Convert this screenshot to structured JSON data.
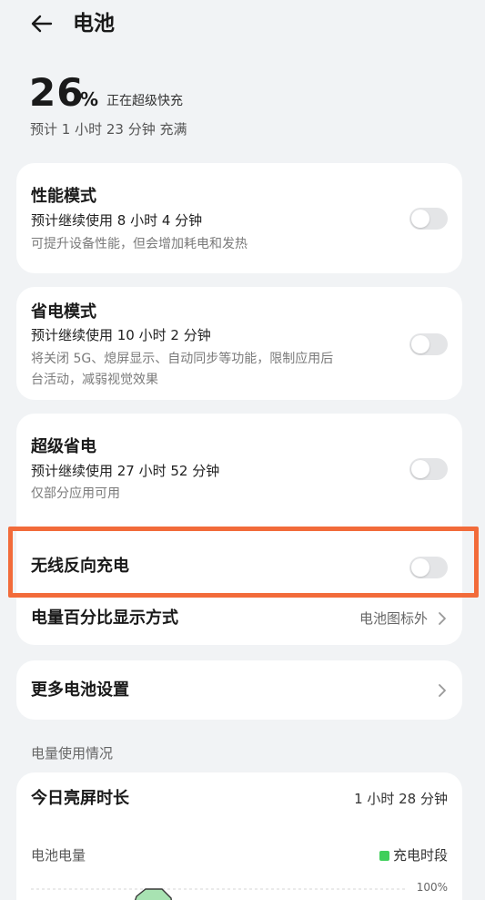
{
  "header": {
    "title": "电池"
  },
  "battery": {
    "percent": "26",
    "percent_sign": "%",
    "status": "正在超级快充",
    "eta": "预计 1 小时 23 分钟 充满"
  },
  "performance_mode": {
    "title": "性能模式",
    "line1": "预计继续使用 8 小时 4 分钟",
    "desc": "可提升设备性能，但会增加耗电和发热",
    "enabled": false
  },
  "power_saving_mode": {
    "title": "省电模式",
    "line1": "预计继续使用 10 小时 2 分钟",
    "desc_line1": "将关闭 5G、熄屏显示、自动同步等功能，限制应用后",
    "desc_line2": "台活动，减弱视觉效果",
    "enabled": false
  },
  "ultra_power_saving": {
    "title": "超级省电",
    "line1": "预计继续使用 27 小时 52 分钟",
    "desc": "仅部分应用可用",
    "enabled": false
  },
  "wireless_reverse_charging": {
    "title": "无线反向充电",
    "enabled": false
  },
  "battery_percentage_display": {
    "label": "电量百分比显示方式",
    "value": "电池图标外"
  },
  "more_settings": {
    "label": "更多电池设置"
  },
  "usage": {
    "section_label": "电量使用情况",
    "screen_time_title": "今日亮屏时长",
    "screen_time_value": "1 小时 28 分钟",
    "battery_level_label": "电池电量",
    "legend_charging": "充电时段",
    "axis_100": "100%"
  },
  "colors": {
    "accent_highlight": "#f26b3a",
    "charging_green": "#3fcf5a",
    "toggle_off": "#e4e5e7"
  }
}
